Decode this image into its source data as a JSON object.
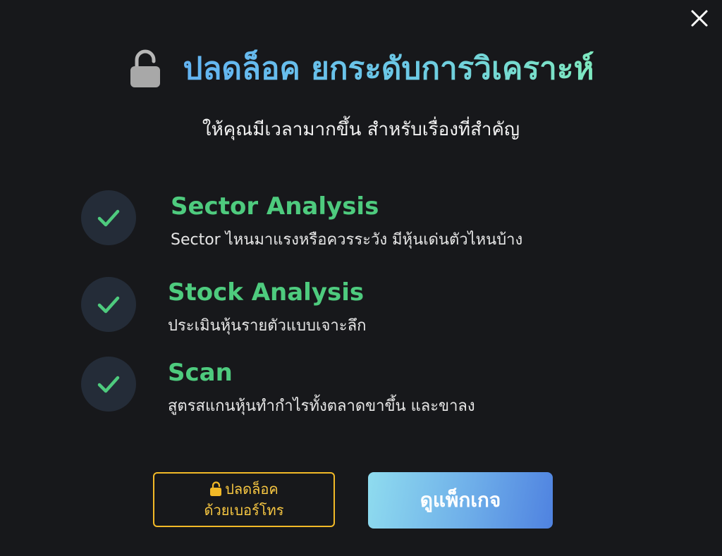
{
  "header": {
    "title": "ปลดล็อค ยกระดับการวิเคราะห์",
    "subtitle": "ให้คุณมีเวลามากขึ้น สำหรับเรื่องที่สำคัญ"
  },
  "features": [
    {
      "title": "Sector Analysis",
      "description": "Sector ไหนมาแรงหรือควรระวัง มีหุ้นเด่นตัวไหนบ้าง"
    },
    {
      "title": "Stock Analysis",
      "description": "ประเมินหุ้นรายตัวแบบเจาะลึก"
    },
    {
      "title": "Scan",
      "description": "สูตรสแกนหุ้นทำกำไรทั้งตลาดขาขึ้น และขาลง"
    }
  ],
  "buttons": {
    "unlock_line1": "ปลดล็อค",
    "unlock_line2": "ด้วยเบอร์โทร",
    "packages_label": "ดูแพ็กเกจ"
  },
  "icons": {
    "close": "close-icon",
    "lock": "unlocked-padlock-icon",
    "check": "check-icon"
  },
  "colors": {
    "background": "#17181b",
    "feature_title": "#4ecb7e",
    "check_circle": "#242c38",
    "unlock_button_border": "#f2b927",
    "package_button_start": "#8fdcef",
    "package_button_end": "#4f82e0"
  }
}
